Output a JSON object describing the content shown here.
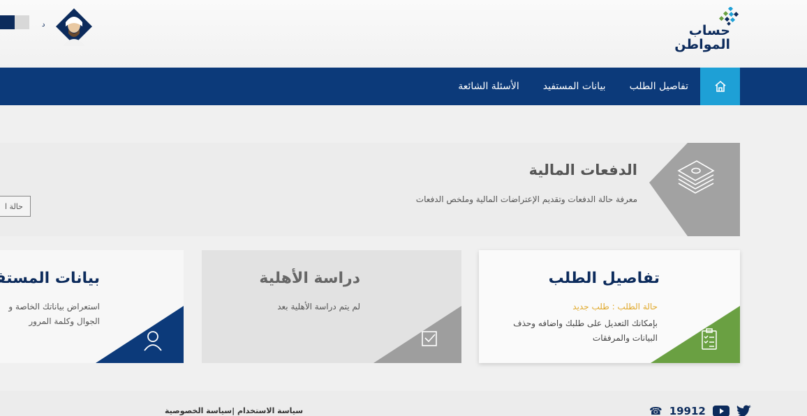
{
  "header": {
    "logo_line1": "حساب",
    "logo_line2": "المواطن",
    "user_caret": "د",
    "brand_color": "#0c2b5c"
  },
  "nav": {
    "items": [
      {
        "label": "تفاصيل الطلب"
      },
      {
        "label": "بيانات المستفيد"
      },
      {
        "label": "الأسئلة الشائعة"
      }
    ],
    "home_icon": "home-icon"
  },
  "payments": {
    "title": "الدفعات المالية",
    "description": "معرفة حالة الدفعات وتقديم الإعتراضات المالية وملخص الدفعات",
    "button_label": "حالة ا",
    "icon": "money-stack-icon"
  },
  "cards": {
    "request": {
      "title": "تفاصيل الطلب",
      "status": "حالة الطلب : طلب جديد",
      "text": "بإمكانك التعديل على طلبك واضافه وحذف البيانات والمرفقات",
      "icon": "clipboard-checklist-icon",
      "accent": "#6aa042"
    },
    "eligibility": {
      "title": "دراسة الأهلية",
      "text": "لم يتم دراسة الأهلية بعد",
      "icon": "checkbox-icon",
      "accent": "#9e9e9e"
    },
    "beneficiary": {
      "title": "بيانات المستفي",
      "text_line1": "استعراض بياناتك الخاصة و",
      "text_line2": "الجوال وكلمة المرور",
      "icon": "user-icon",
      "accent": "#0c3a7a"
    }
  },
  "footer": {
    "links": "سياسة الاستخدام |سياسة الخصوصية",
    "phone": "19912",
    "social": [
      "twitter-icon",
      "youtube-icon",
      "phone-icon"
    ]
  }
}
